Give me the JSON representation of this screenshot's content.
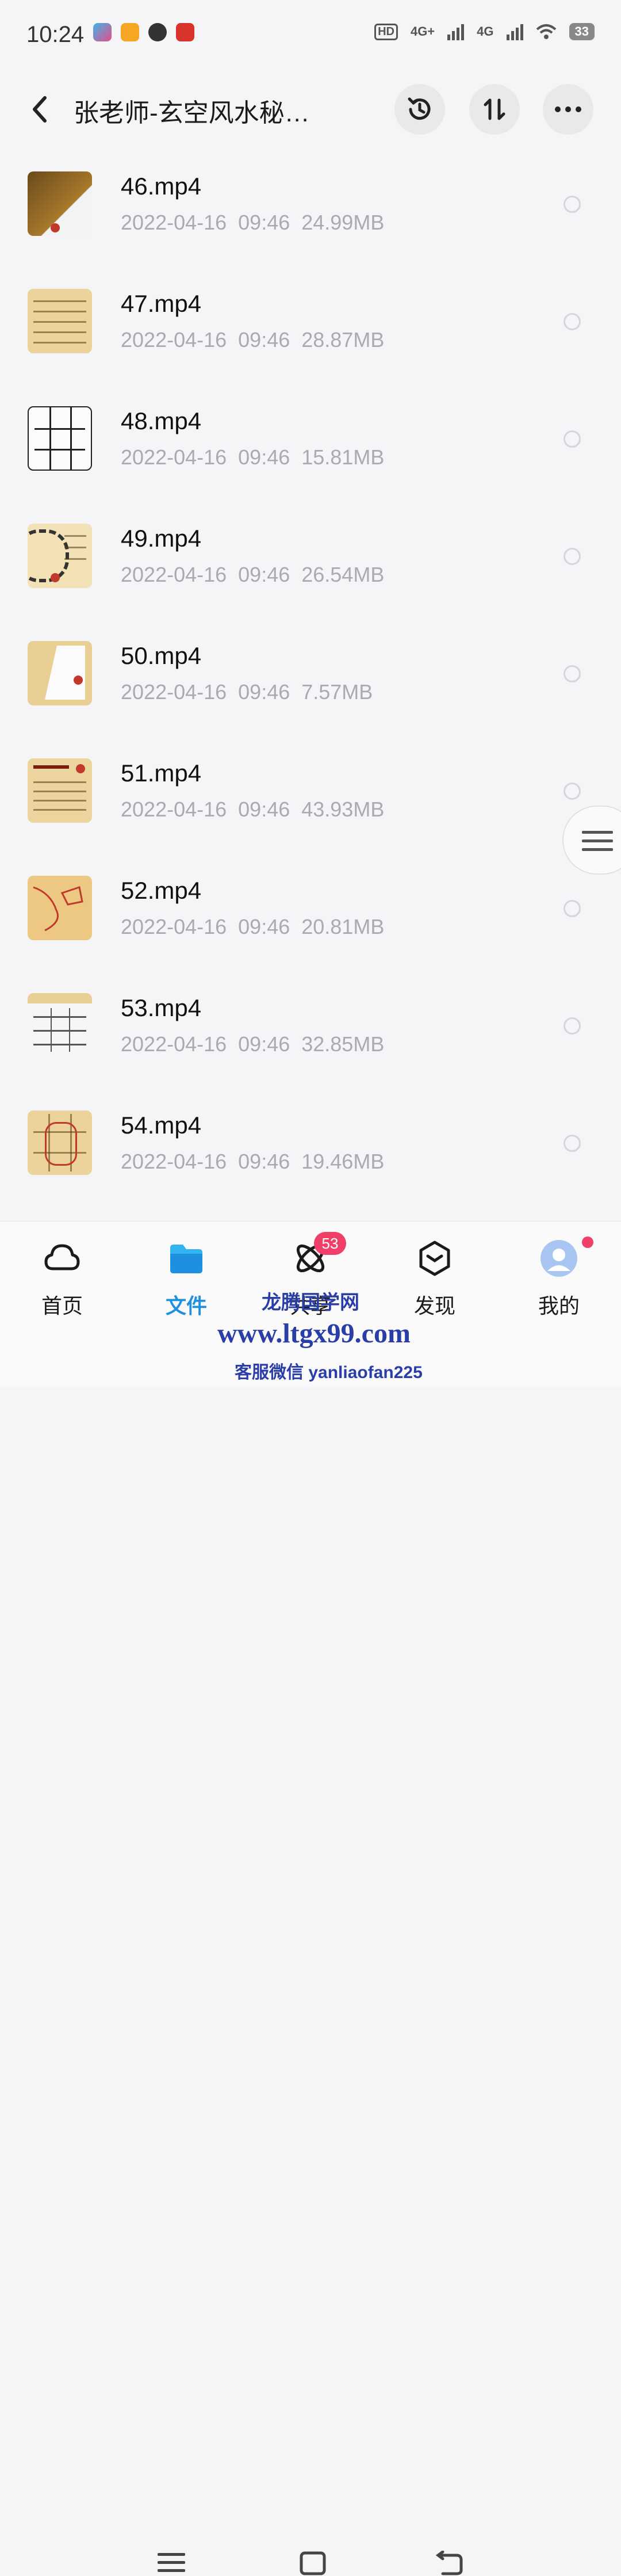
{
  "status_bar": {
    "time": "10:24",
    "hd_label": "HD",
    "net1": "4G+",
    "net2": "4G",
    "battery": "33"
  },
  "header": {
    "title": "张老师-玄空风水秘…"
  },
  "files": [
    {
      "name": "46.mp4",
      "meta": "2022-04-16  09:46  24.99MB"
    },
    {
      "name": "47.mp4",
      "meta": "2022-04-16  09:46  28.87MB"
    },
    {
      "name": "48.mp4",
      "meta": "2022-04-16  09:46  15.81MB"
    },
    {
      "name": "49.mp4",
      "meta": "2022-04-16  09:46  26.54MB"
    },
    {
      "name": "50.mp4",
      "meta": "2022-04-16  09:46  7.57MB"
    },
    {
      "name": "51.mp4",
      "meta": "2022-04-16  09:46  43.93MB"
    },
    {
      "name": "52.mp4",
      "meta": "2022-04-16  09:46  20.81MB"
    },
    {
      "name": "53.mp4",
      "meta": "2022-04-16  09:46  32.85MB"
    },
    {
      "name": "54.mp4",
      "meta": "2022-04-16  09:46  19.46MB"
    }
  ],
  "nav": {
    "home": "首页",
    "files": "文件",
    "share": "共享",
    "share_badge": "53",
    "discover": "发现",
    "mine": "我的"
  },
  "watermark": {
    "line1": "龙腾国学网",
    "line2": "www.ltgx99.com",
    "line3": "客服微信 yanliaofan225"
  },
  "colors": {
    "accent": "#1f8fe0",
    "badge": "#f0406a",
    "watermark": "#2a3ea8"
  }
}
